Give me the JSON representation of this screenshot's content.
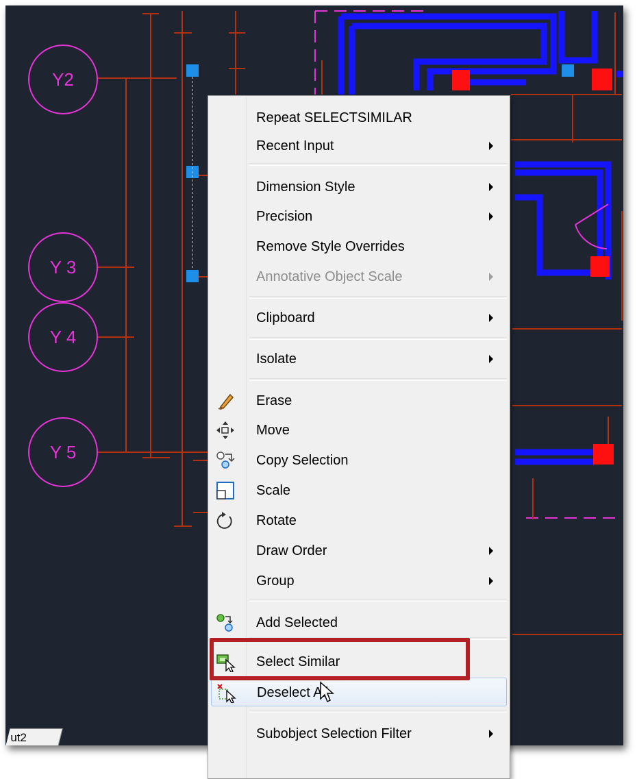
{
  "colors": {
    "canvas": "#1f2530",
    "axis_bubble": "#e534d8",
    "dimension_lines": "#b4310f",
    "walls": "#1414ff",
    "grips": "#1e8fe8",
    "door_blocks": "#ff1010",
    "highlight_box": "#b22024"
  },
  "drawing": {
    "axis_labels": [
      "Y2",
      "Y 3",
      "Y 4",
      "Y 5"
    ],
    "layout_tab": "ut2"
  },
  "context_menu": {
    "items": [
      {
        "label": "Repeat SELECTSIMILAR",
        "submenu": false,
        "icon": ""
      },
      {
        "label": "Recent Input",
        "submenu": true,
        "icon": ""
      },
      {
        "label": "Dimension Style",
        "submenu": true,
        "icon": ""
      },
      {
        "label": "Precision",
        "submenu": true,
        "icon": ""
      },
      {
        "label": "Remove Style Overrides",
        "submenu": false,
        "icon": ""
      },
      {
        "label": "Annotative Object Scale",
        "submenu": true,
        "icon": "",
        "disabled": true
      },
      {
        "label": "Clipboard",
        "submenu": true,
        "icon": ""
      },
      {
        "label": "Isolate",
        "submenu": true,
        "icon": ""
      },
      {
        "label": "Erase",
        "submenu": false,
        "icon": "eraser-icon"
      },
      {
        "label": "Move",
        "submenu": false,
        "icon": "move-icon"
      },
      {
        "label": "Copy Selection",
        "submenu": false,
        "icon": "copy-selection-icon"
      },
      {
        "label": "Scale",
        "submenu": false,
        "icon": "scale-icon"
      },
      {
        "label": "Rotate",
        "submenu": false,
        "icon": "rotate-icon"
      },
      {
        "label": "Draw Order",
        "submenu": true,
        "icon": ""
      },
      {
        "label": "Group",
        "submenu": true,
        "icon": ""
      },
      {
        "label": "Add Selected",
        "submenu": false,
        "icon": "add-selected-icon"
      },
      {
        "label": "Select Similar",
        "submenu": false,
        "icon": "select-similar-icon"
      },
      {
        "label": "Deselect All",
        "submenu": false,
        "icon": "deselect-all-icon",
        "hovered": true
      },
      {
        "label": "Subobject Selection Filter",
        "submenu": true,
        "icon": ""
      }
    ]
  }
}
